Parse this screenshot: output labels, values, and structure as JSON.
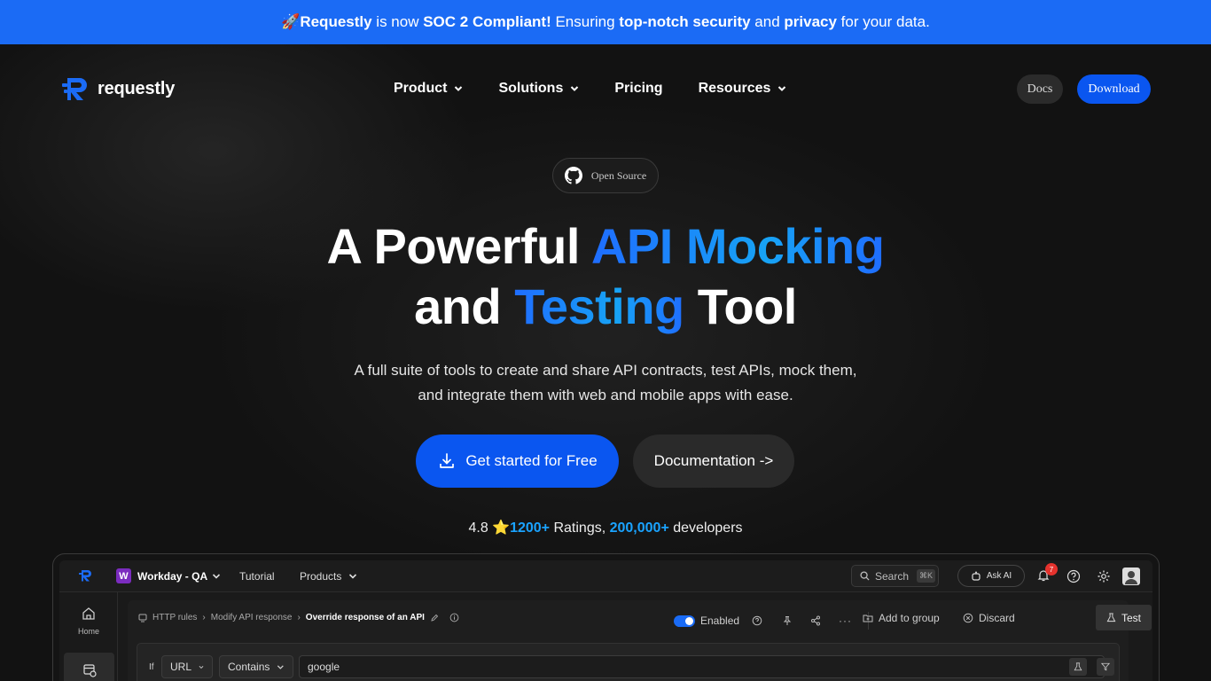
{
  "banner": {
    "rocket": "🚀",
    "brand": "Requestly",
    "t1": " is now ",
    "soc": "SOC 2 Compliant!",
    "t2": " Ensuring ",
    "security": "top-notch security",
    "t3": " and ",
    "privacy": "privacy",
    "t4": " for your data."
  },
  "nav": {
    "logo_text": "requestly",
    "items": [
      {
        "label": "Product",
        "has_dropdown": true
      },
      {
        "label": "Solutions",
        "has_dropdown": true
      },
      {
        "label": "Pricing",
        "has_dropdown": false
      },
      {
        "label": "Resources",
        "has_dropdown": true
      }
    ],
    "docs_label": "Docs",
    "download_label": "Download"
  },
  "hero": {
    "badge": "Open Source",
    "title_1": "A Powerful ",
    "title_grad_1": "API Mocking",
    "title_2": "and ",
    "title_grad_2": "Testing",
    "title_3": " Tool",
    "sub_1": "A full suite of tools to create and share API contracts, test APIs, mock them,",
    "sub_2": "and integrate them with web and mobile apps with ease.",
    "cta_primary": "Get started for Free",
    "cta_secondary": "Documentation ->",
    "rating_value": "4.8 ",
    "rating_star": "⭐",
    "ratings_count": "1200+",
    "ratings_word": " Ratings, ",
    "dev_count": "200,000+",
    "dev_word": " developers"
  },
  "app": {
    "workspace_badge": "W",
    "workspace": "Workday - QA",
    "tutorial": "Tutorial",
    "products": "Products",
    "search": "Search",
    "search_kbd": "⌘K",
    "ask_ai": "Ask AI",
    "notif_count": "7",
    "side_home": "Home",
    "crumb_1": "HTTP rules",
    "crumb_2": "Modify API response",
    "crumb_3": "Override response of an API",
    "enabled": "Enabled",
    "add_to_group": "Add to group",
    "discard": "Discard",
    "test": "Test",
    "if_label": "If",
    "field_url": "URL",
    "field_contains": "Contains",
    "field_value": "google"
  },
  "colors": {
    "banner": "#1b6bf5",
    "primary": "#0a56f0",
    "accent_text": "#1aa3ff"
  }
}
